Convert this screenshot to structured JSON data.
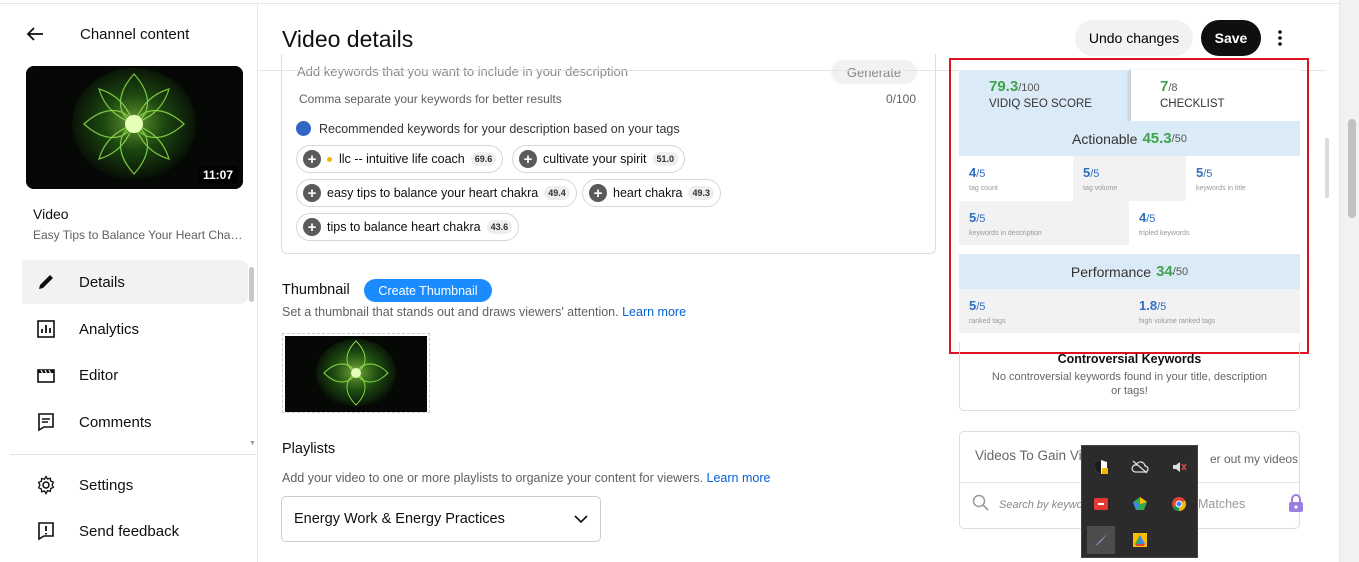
{
  "sidebar": {
    "back_label": "Channel content",
    "video_duration": "11:07",
    "video_label": "Video",
    "video_title": "Easy Tips to Balance Your Heart Chakra",
    "nav": [
      {
        "label": "Details",
        "icon": "pencil-icon",
        "active": true
      },
      {
        "label": "Analytics",
        "icon": "analytics-icon"
      },
      {
        "label": "Editor",
        "icon": "clapperboard-icon"
      },
      {
        "label": "Comments",
        "icon": "comment-icon"
      }
    ],
    "bottom_nav": [
      {
        "label": "Settings",
        "icon": "gear-icon"
      },
      {
        "label": "Send feedback",
        "icon": "feedback-icon"
      }
    ]
  },
  "header": {
    "title": "Video details",
    "undo_label": "Undo changes",
    "save_label": "Save"
  },
  "keywords": {
    "input_placeholder": "Add keywords that you want to include in your description",
    "generate_label": "Generate",
    "hint": "Comma separate your keywords for better results",
    "count": "0/100",
    "recommended_text": "Recommended keywords for your description based on your tags",
    "chips": [
      {
        "label": "llc -- intuitive life coach",
        "score": "69.6"
      },
      {
        "label": "cultivate your spirit",
        "score": "51.0"
      },
      {
        "label": "easy tips to balance your heart chakra",
        "score": "49.4"
      },
      {
        "label": "heart chakra",
        "score": "49.3"
      },
      {
        "label": "tips to balance heart chakra",
        "score": "43.6"
      }
    ]
  },
  "thumbnail": {
    "heading": "Thumbnail",
    "create_label": "Create Thumbnail",
    "desc": "Set a thumbnail that stands out and draws viewers' attention.",
    "learn_more": "Learn more"
  },
  "playlists": {
    "heading": "Playlists",
    "desc": "Add your video to one or more playlists to organize your content for viewers.",
    "learn_more": "Learn more",
    "selected": "Energy Work & Energy Practices"
  },
  "vidiq": {
    "seo_score": "79.3",
    "seo_max": "/100",
    "seo_label": "VIDIQ SEO SCORE",
    "checklist_score": "7",
    "checklist_max": "/8",
    "checklist_label": "CHECKLIST",
    "actionable_label": "Actionable",
    "actionable_score": "45.3",
    "actionable_max": "/50",
    "metrics_row1": [
      {
        "value": "4",
        "max": "/5",
        "label": "tag count"
      },
      {
        "value": "5",
        "max": "/5",
        "label": "tag volume"
      },
      {
        "value": "5",
        "max": "/5",
        "label": "keywords in title"
      }
    ],
    "metrics_row2": [
      {
        "value": "5",
        "max": "/5",
        "label": "keywords in description"
      },
      {
        "value": "4",
        "max": "/5",
        "label": "tripled keywords"
      }
    ],
    "performance_label": "Performance",
    "performance_score": "34",
    "performance_max": "/50",
    "metrics_row3": [
      {
        "value": "5",
        "max": "/5",
        "label": "ranked tags"
      },
      {
        "value": "1.8",
        "max": "/5",
        "label": "high volume ranked tags"
      }
    ],
    "controversial_title": "Controversial Keywords",
    "controversial_desc": "No controversial keywords found in your title, description or tags!",
    "gain_title": "Videos To Gain Vi",
    "gain_right": "er out my videos",
    "gain_search_placeholder": "Search by keywo",
    "gain_matches": "Matches"
  },
  "colors": {
    "accent_green": "#3fa34d",
    "accent_blue": "#2f6fbf",
    "band_blue": "#dbeaf7",
    "highlight_red": "#d9141e",
    "button_blue": "#1a8cff"
  }
}
